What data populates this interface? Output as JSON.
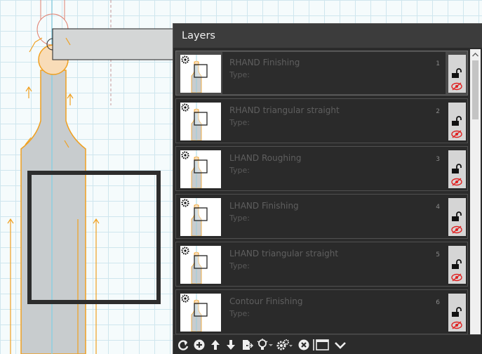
{
  "window": {
    "title": "Layers"
  },
  "layers": [
    {
      "name": "RHAND Finishing",
      "type_label": "Type:",
      "number": "1",
      "selected": true
    },
    {
      "name": "RHAND triangular straight",
      "type_label": "Type:",
      "number": "2",
      "selected": false
    },
    {
      "name": "LHAND Roughing",
      "type_label": "Type:",
      "number": "3",
      "selected": false
    },
    {
      "name": "LHAND Finishing",
      "type_label": "Type:",
      "number": "4",
      "selected": false
    },
    {
      "name": "LHAND triangular straight",
      "type_label": "Type:",
      "number": "5",
      "selected": false
    },
    {
      "name": "Contour Finishing",
      "type_label": "Type:",
      "number": "6",
      "selected": false
    }
  ],
  "layer_icons": {
    "lock": "unlock-icon",
    "visibility": "eye-hidden-icon",
    "thumbnail_badge": "gear-icon"
  },
  "toolbar": {
    "buttons": [
      "refresh-icon",
      "add-icon",
      "move-up-icon",
      "move-down-icon",
      "export-icon",
      "bulb-icon",
      "gears-icon",
      "delete-icon",
      "window-icon",
      "chevron-down-icon"
    ]
  },
  "colors": {
    "panel_bg": "#2b2b2b",
    "header_bg": "#3c3c3c",
    "selected_row": "#4a4a4a",
    "toolpath_orange": "#f0a020",
    "part_gray": "#c8ccce",
    "hidden_eye_red": "#e02020"
  }
}
